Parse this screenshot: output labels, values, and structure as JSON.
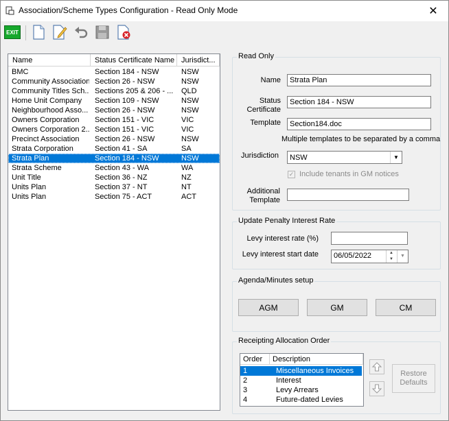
{
  "window": {
    "title": "Association/Scheme Types Configuration - Read Only Mode",
    "close_glyph": "✕"
  },
  "toolbar": {
    "exit_label": "EXIT"
  },
  "list": {
    "columns": [
      "Name",
      "Status Certificate Name",
      "Jurisdict..."
    ],
    "rows": [
      [
        "BMC",
        "Section 184 - NSW",
        "NSW"
      ],
      [
        "Community Association",
        "Section 26 - NSW",
        "NSW"
      ],
      [
        "Community Titles Sch...",
        "Sections 205 & 206 - ...",
        "QLD"
      ],
      [
        "Home Unit Company",
        "Section 109 - NSW",
        "NSW"
      ],
      [
        "Neighbourhood Asso...",
        "Section 26 - NSW",
        "NSW"
      ],
      [
        "Owners Corporation",
        "Section 151 - VIC",
        "VIC"
      ],
      [
        "Owners Corporation 2...",
        "Section 151 - VIC",
        "VIC"
      ],
      [
        "Precinct Association",
        "Section 26 - NSW",
        "NSW"
      ],
      [
        "Strata Corporation",
        "Section 41 - SA",
        "SA"
      ],
      [
        "Strata Plan",
        "Section 184 - NSW",
        "NSW"
      ],
      [
        "Strata Scheme",
        "Section 43 - WA",
        "WA"
      ],
      [
        "Unit Title",
        "Section 36 - NZ",
        "NZ"
      ],
      [
        "Units Plan",
        "Section 37 - NT",
        "NT"
      ],
      [
        "Units Plan",
        "Section 75 - ACT",
        "ACT"
      ]
    ],
    "selected_index": 9
  },
  "read_only": {
    "title": "Read Only",
    "name_label": "Name",
    "name_value": "Strata Plan",
    "status_label_1": "Status",
    "status_label_2": "Certificate",
    "status_value": "Section 184 - NSW",
    "template_label": "Template",
    "template_value": "Section184.doc",
    "template_note": "Multiple templates to be separated by a comma",
    "jurisdiction_label": "Jurisdiction",
    "jurisdiction_value": "NSW",
    "include_tenants_label": "Include tenants in GM notices",
    "additional_label_1": "Additional",
    "additional_label_2": "Template",
    "additional_value": ""
  },
  "penalty": {
    "title": "Update Penalty Interest Rate",
    "levy_rate_label": "Levy interest rate (%)",
    "levy_rate_value": "",
    "levy_date_label": "Levy interest start date",
    "levy_date_value": "06/05/2022"
  },
  "agenda": {
    "title": "Agenda/Minutes setup",
    "agm_label": "AGM",
    "gm_label": "GM",
    "cm_label": "CM"
  },
  "receipting": {
    "title": "Receipting Allocation Order",
    "columns": [
      "Order",
      "Description"
    ],
    "rows": [
      [
        "1",
        "Miscellaneous Invoices"
      ],
      [
        "2",
        "Interest"
      ],
      [
        "3",
        "Levy Arrears"
      ],
      [
        "4",
        "Future-dated Levies"
      ]
    ],
    "restore_line1": "Restore",
    "restore_line2": "Defaults"
  }
}
